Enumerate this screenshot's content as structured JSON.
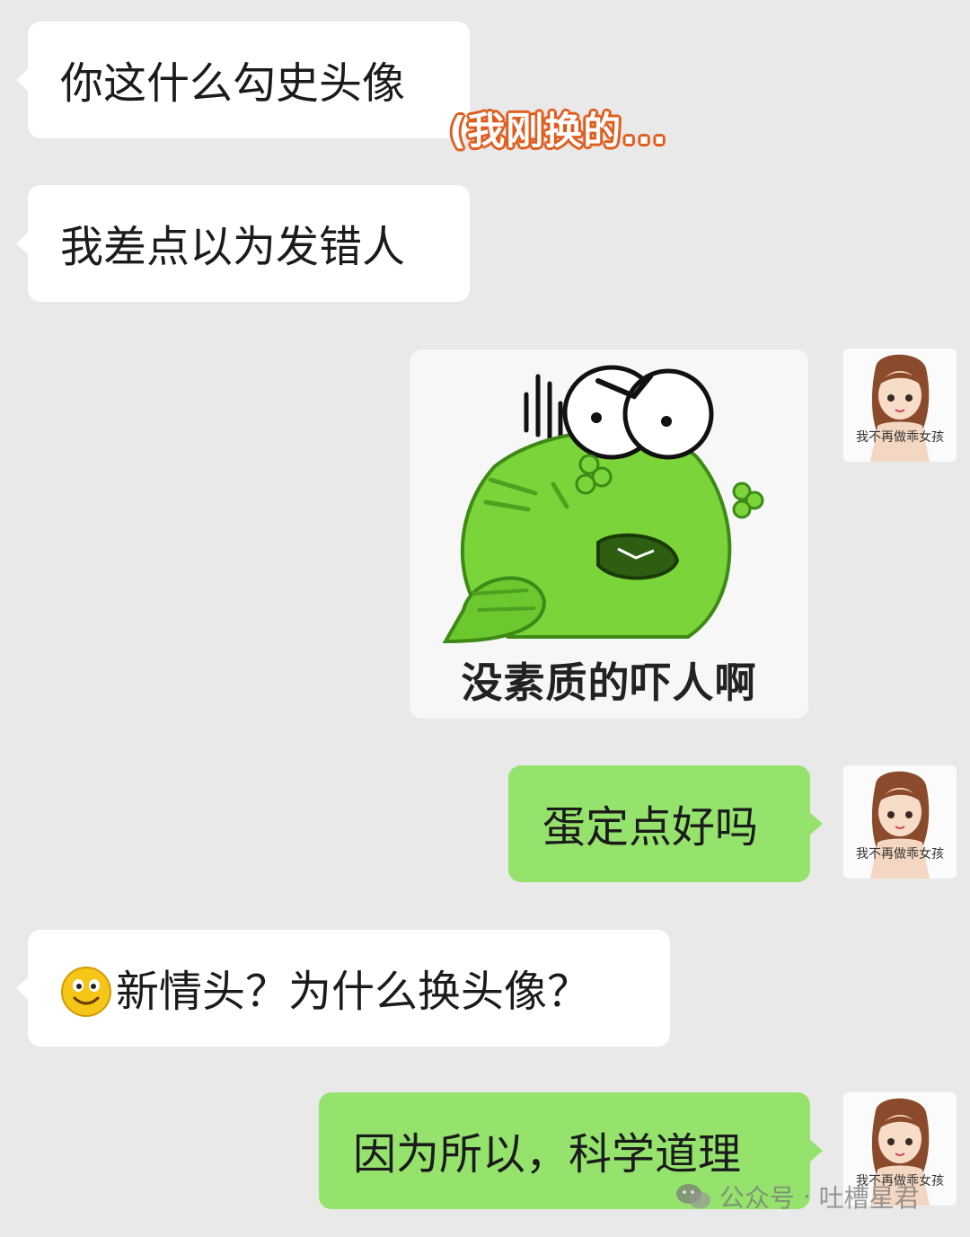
{
  "messages": [
    {
      "text": "你这什么勾史头像"
    },
    {
      "text": "我差点以为发错人"
    },
    {
      "sticker_caption": "没素质的吓人啊"
    },
    {
      "text": "蛋定点好吗"
    },
    {
      "text": "新情头？为什么换头像？"
    },
    {
      "text": "因为所以，科学道理"
    }
  ],
  "annotation": "(我刚换的...",
  "avatar": {
    "label": "我不再做乖女孩"
  },
  "watermark": {
    "prefix": "公众号",
    "separator": "·",
    "account": "吐槽星君"
  },
  "colors": {
    "background": "#e9e9e9",
    "incoming_bubble": "#ffffff",
    "outgoing_bubble": "#95e36d",
    "annotation_outline": "#e05d1e"
  },
  "icons": {
    "emoji": "smiley-emoji",
    "watermark": "wechat-icon"
  }
}
